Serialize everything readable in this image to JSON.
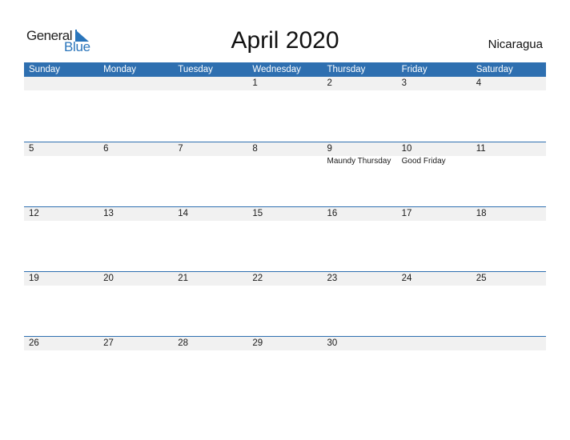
{
  "logo": {
    "general": "General",
    "blue": "Blue"
  },
  "title": "April 2020",
  "country": "Nicaragua",
  "colors": {
    "accent": "#2e6fb0",
    "row_shade": "#f1f1f1"
  },
  "weekdays": [
    "Sunday",
    "Monday",
    "Tuesday",
    "Wednesday",
    "Thursday",
    "Friday",
    "Saturday"
  ],
  "weeks": [
    {
      "dates": [
        "",
        "",
        "",
        "1",
        "2",
        "3",
        "4"
      ],
      "holidays": [
        "",
        "",
        "",
        "",
        "",
        "",
        ""
      ]
    },
    {
      "dates": [
        "5",
        "6",
        "7",
        "8",
        "9",
        "10",
        "11"
      ],
      "holidays": [
        "",
        "",
        "",
        "",
        "Maundy Thursday",
        "Good Friday",
        ""
      ]
    },
    {
      "dates": [
        "12",
        "13",
        "14",
        "15",
        "16",
        "17",
        "18"
      ],
      "holidays": [
        "",
        "",
        "",
        "",
        "",
        "",
        ""
      ]
    },
    {
      "dates": [
        "19",
        "20",
        "21",
        "22",
        "23",
        "24",
        "25"
      ],
      "holidays": [
        "",
        "",
        "",
        "",
        "",
        "",
        ""
      ]
    },
    {
      "dates": [
        "26",
        "27",
        "28",
        "29",
        "30",
        "",
        ""
      ],
      "holidays": [
        "",
        "",
        "",
        "",
        "",
        "",
        ""
      ]
    }
  ]
}
